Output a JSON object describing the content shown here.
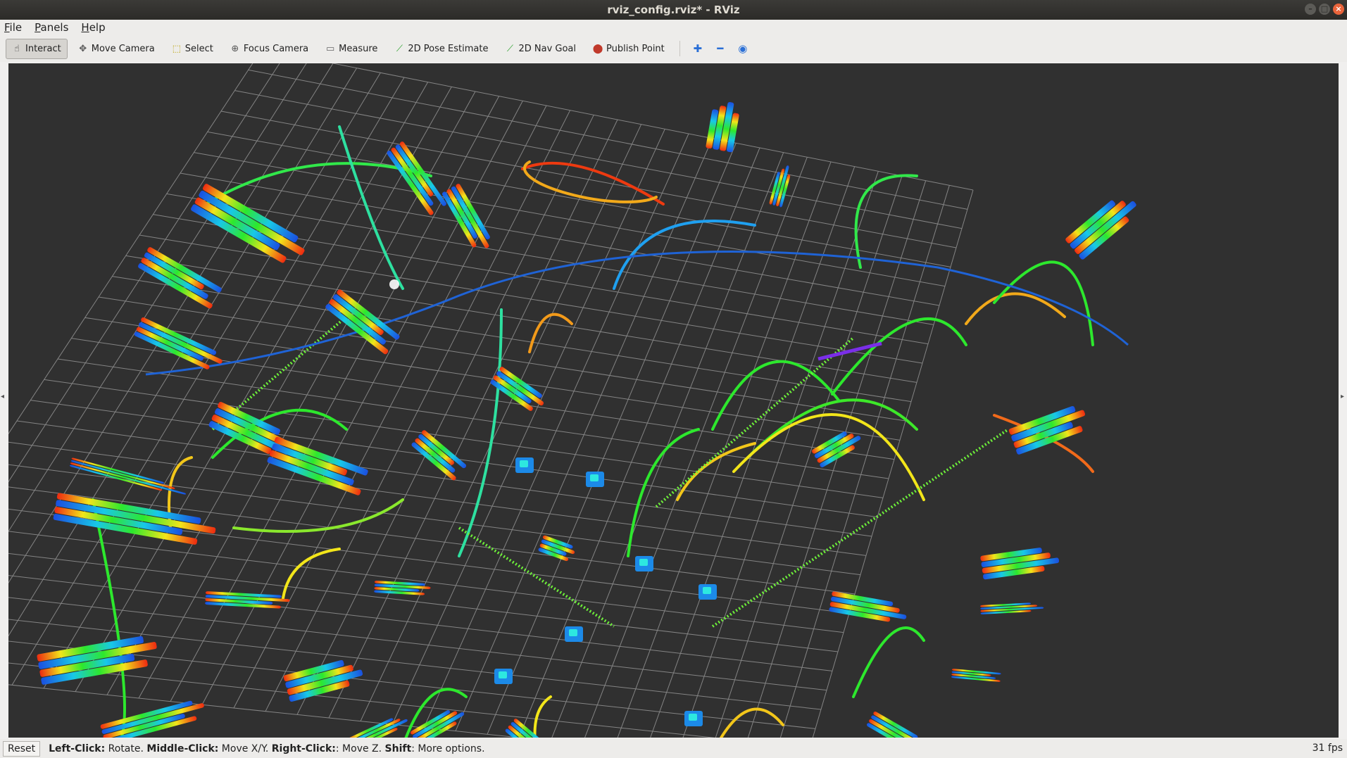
{
  "window": {
    "title": "rviz_config.rviz* - RViz",
    "controls": [
      "–",
      "□",
      "×"
    ]
  },
  "menu": [
    {
      "mnemonic": "F",
      "rest": "ile"
    },
    {
      "mnemonic": "P",
      "rest": "anels"
    },
    {
      "mnemonic": "H",
      "rest": "elp"
    }
  ],
  "toolbar": {
    "tools": [
      {
        "label": "Interact",
        "icon": "hand-icon",
        "glyph": "☝",
        "color": "#333333",
        "active": true
      },
      {
        "label": "Move Camera",
        "icon": "move-camera-icon",
        "glyph": "✥",
        "color": "#555555",
        "active": false
      },
      {
        "label": "Select",
        "icon": "select-icon",
        "glyph": "⬚",
        "color": "#b8a000",
        "active": false
      },
      {
        "label": "Focus Camera",
        "icon": "focus-camera-icon",
        "glyph": "⊕",
        "color": "#555555",
        "active": false
      },
      {
        "label": "Measure",
        "icon": "ruler-icon",
        "glyph": "▭",
        "color": "#666666",
        "active": false
      },
      {
        "label": "2D Pose Estimate",
        "icon": "pose-estimate-arrow-icon",
        "glyph": "⟋",
        "color": "#2aa12a",
        "active": false
      },
      {
        "label": "2D Nav Goal",
        "icon": "nav-goal-arrow-icon",
        "glyph": "⟋",
        "color": "#2aa12a",
        "active": false
      },
      {
        "label": "Publish Point",
        "icon": "map-pin-icon",
        "glyph": "⬤",
        "color": "#c0392b",
        "active": false
      }
    ],
    "extra": [
      {
        "icon": "add-tool-icon",
        "glyph": "✚"
      },
      {
        "icon": "remove-tool-icon",
        "glyph": "━"
      },
      {
        "icon": "view-options-icon",
        "glyph": "◉"
      }
    ]
  },
  "status": {
    "reset": "Reset",
    "hints": [
      {
        "key": "Left-Click:",
        "text": " Rotate. "
      },
      {
        "key": "Middle-Click:",
        "text": " Move X/Y. "
      },
      {
        "key": "Right-Click:",
        "text": ": Move Z. "
      },
      {
        "key": "Shift",
        "text": ": More options."
      }
    ],
    "fps": "31 fps"
  },
  "colors": {
    "viewport_bg": "#303030",
    "grid": "#a0a0a0",
    "trajectory": "#1f63d6"
  }
}
